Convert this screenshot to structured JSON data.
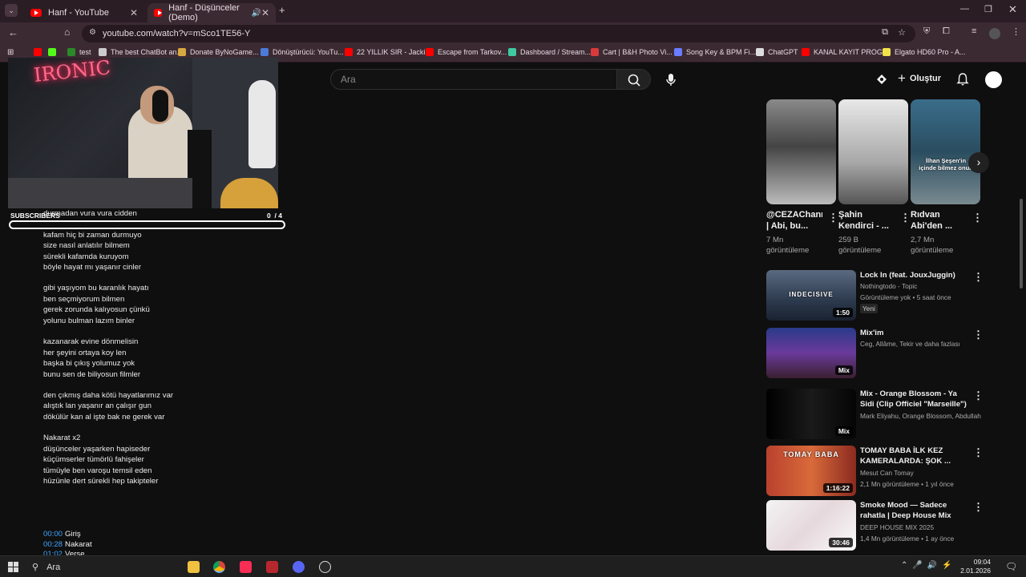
{
  "browser": {
    "tabs": [
      {
        "title": "Hanf - YouTube",
        "active": false
      },
      {
        "title": "Hanf - Düşünceler (Demo)",
        "active": true
      }
    ],
    "url": "youtube.com/watch?v=mSco1TE56-Y",
    "bookmarks": [
      {
        "label": "test",
        "color": "#2a8a2a"
      },
      {
        "label": "The best ChatBot an...",
        "color": "#cccccc"
      },
      {
        "label": "Donate ByNoGame...",
        "color": "#d8a840"
      },
      {
        "label": "Dönüştürücü: YouTu...",
        "color": "#4a7bd8"
      },
      {
        "label": "22 YILLIK SIR - Jacki...",
        "color": "#ff0000"
      },
      {
        "label": "Escape from Tarkov...",
        "color": "#ff0000"
      },
      {
        "label": "Dashboard / Stream...",
        "color": "#3ec9a0"
      },
      {
        "label": "Cart | B&H Photo Vi...",
        "color": "#d83a3a"
      },
      {
        "label": "Song Key & BPM Fi...",
        "color": "#6a7cff"
      },
      {
        "label": "ChatGPT",
        "color": "#dddddd"
      },
      {
        "label": "KANAL KAYIT PROG...",
        "color": "#ff0000"
      },
      {
        "label": "Elgato HD60 Pro - A...",
        "color": "#f2e34a"
      }
    ]
  },
  "masthead": {
    "search_placeholder": "Ara",
    "create_label": "Oluştur"
  },
  "overlay": {
    "neon_text": "IRONIC",
    "subscribers_label": "SUBSCRIBERS",
    "subscribers_count": "0",
    "subscribers_goal": "/ 4"
  },
  "lyrics": {
    "lines": [
      "durmadan vura vura cidden",
      "kafam hiç bi zaman durmuyo",
      "size nasıl anlatılır bilmem",
      "sürekli kafamda kuruyom",
      "böyle hayat mı yaşanır cinler",
      "gibi yaşıyom bu karanlık hayatı",
      "ben seçmiyorum bilmen",
      "gerek zorunda kalıyosun çünkü",
      "yolunu bulman lazım binler",
      "kazanarak evine dönmelisin",
      "her şeyini ortaya koy len",
      "başka bi çıkış yolumuz yok",
      "bunu sen de biliyosun filmler",
      "den çıkmış daha kötü hayatlarımız var",
      "alıştık lan yaşanır an çalışır gun",
      "dökülür kan al işte bak ne gerek var",
      "Nakarat x2",
      "düşünceler yaşarken hapiseder",
      "küçümserler tümörlü fahişeler",
      "tümüyle ben varoşu temsil eden",
      "hüzünle dert sürekli hep takipteler"
    ],
    "chapters": [
      {
        "time": "00:00",
        "label": "Giriş"
      },
      {
        "time": "00:28",
        "label": "Nakarat"
      },
      {
        "time": "01:02",
        "label": "Verse"
      }
    ]
  },
  "shorts": [
    {
      "title": "@CEZAChannel | Abi, bu...",
      "views": "7 Mn görüntüleme",
      "overlay": ""
    },
    {
      "title": "Şahin Kendirci - ...",
      "views": "259 B görüntüleme",
      "overlay": ""
    },
    {
      "title": "Rıdvan Abi'den ...",
      "views": "2,7 Mn görüntüleme",
      "overlay": "İlhan Şeşen'in içinde bilmez onun"
    }
  ],
  "recommendations": [
    {
      "title": "Lock In (feat. JouxJuggin)",
      "channel": "Nothingtodo - Topic",
      "meta": "Görüntüleme yok • 5 saat önce",
      "badge": "Yeni",
      "duration": "1:50",
      "thumb_text": "INDECISIVE"
    },
    {
      "title": "Mix'im",
      "channel": "Ceg, Allâme, Tekir ve daha fazlası",
      "meta": "",
      "badge": "",
      "duration": "Mix",
      "thumb_text": ""
    },
    {
      "title": "Mix - Orange Blossom - Ya Sidi (Clip Officiel \"Marseille\")",
      "channel": "Mark Eliyahu, Orange Blossom, Abdullah ...",
      "meta": "",
      "badge": "",
      "duration": "Mix",
      "thumb_text": ""
    },
    {
      "title": "TOMAY BABA İLK KEZ KAMERALARDA: ŞOK ...",
      "channel": "Mesut Can Tomay",
      "meta": "2,1 Mn görüntüleme • 1 yıl önce",
      "badge": "",
      "duration": "1:16:22",
      "thumb_text": "TOMAY BABA"
    },
    {
      "title": "Smoke Mood — Sadece rahatla | Deep House Mix 2025 - Chill / ...",
      "channel": "DEEP HOUSE MIX 2025",
      "meta": "1,4 Mn görüntüleme • 1 ay önce",
      "badge": "",
      "duration": "30:46",
      "thumb_text": ""
    }
  ],
  "taskbar": {
    "search_label": "Ara",
    "time": "09:04",
    "date": "2.01.2026"
  }
}
